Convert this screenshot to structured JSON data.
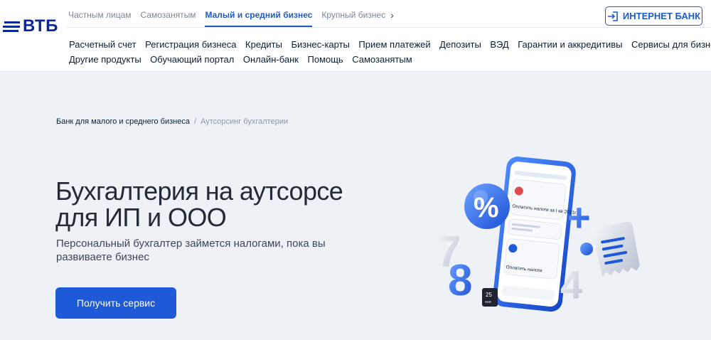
{
  "brand": {
    "logo_text": "ВТБ",
    "color": "#0a2896"
  },
  "segments": [
    {
      "label": "Частным лицам",
      "active": false
    },
    {
      "label": "Самозанятым",
      "active": false
    },
    {
      "label": "Малый и средний бизнес",
      "active": true
    },
    {
      "label": "Крупный бизнес",
      "active": false
    }
  ],
  "internet_bank": {
    "label": "ИНТЕРНЕТ БАНК"
  },
  "nav": {
    "row1": [
      "Расчетный счет",
      "Регистрация бизнеса",
      "Кредиты",
      "Бизнес-карты",
      "Прием платежей",
      "Депозиты",
      "ВЭД",
      "Гарантии и аккредитивы",
      "Сервисы для бизнеса"
    ],
    "row2": [
      "Другие продукты",
      "Обучающий портал",
      "Онлайн-банк",
      "Помощь",
      "Самозанятым"
    ]
  },
  "breadcrumb": {
    "parent": "Банк для малого и среднего бизнеса",
    "separator": "/",
    "current": "Аутсорсинг бухгалтерии"
  },
  "hero": {
    "title_line1": "Бухгалтерия на аутсорсе",
    "title_line2": "для ИП и ООО",
    "subtitle": "Персональный бухгалтер займется налогами, пока вы развиваете бизнес",
    "cta_label": "Получить сервис"
  },
  "illustration": {
    "percent_symbol": "%",
    "plus_symbol": "+",
    "digits": [
      "7",
      "8",
      "4"
    ],
    "phone_card1_text": "Оплатить налоги за I кв 2021г.",
    "phone_card2_text": "Оплатить налоги",
    "phone_badge_day": "25",
    "phone_badge_month": "янв"
  },
  "colors": {
    "accent": "#1e5ad8",
    "page_bg": "#eef2f7",
    "title": "#232b36"
  }
}
